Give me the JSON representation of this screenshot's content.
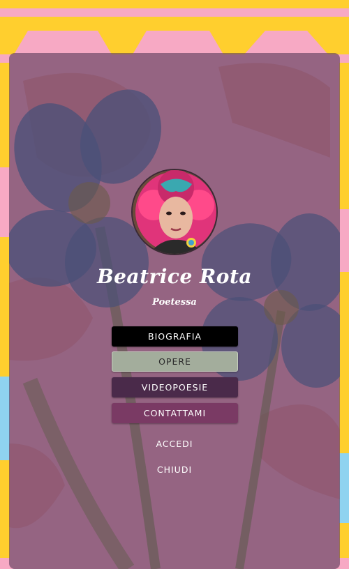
{
  "profile": {
    "name": "Beatrice Rota",
    "subtitle": "Poetessa"
  },
  "buttons": [
    {
      "label": "BIOGRAFIA",
      "bg": "#000000",
      "color": "#ffffff"
    },
    {
      "label": "OPERE",
      "bg": "#a3ad9c",
      "color": "#2a2a2a"
    },
    {
      "label": "VIDEOPOESIE",
      "bg": "#4a2a4a",
      "color": "#ffffff"
    },
    {
      "label": "CONTATTAMI",
      "bg": "#7a3a64",
      "color": "#ffffff"
    }
  ],
  "links": {
    "login": "ACCEDI",
    "close": "CHIUDI"
  },
  "colors": {
    "background_pink": "#f7a9c4",
    "background_yellow": "#ffcf2e",
    "card_overlay": "#583a58"
  }
}
